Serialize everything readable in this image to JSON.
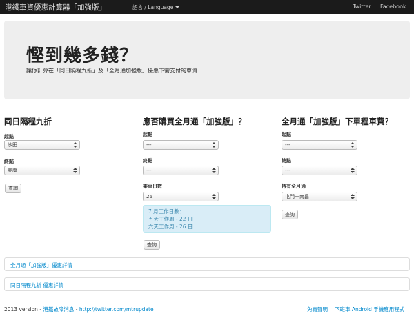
{
  "navbar": {
    "brand": "港鐵車資優惠計算器「加強版」",
    "language": "語言 / Language",
    "twitter": "Twitter",
    "facebook": "Facebook"
  },
  "hero": {
    "title": "慳到幾多錢？",
    "subtitle": "讓你計算在「同日隔程九折」及「全月通加強版」優惠下需支付的車資"
  },
  "col1": {
    "heading": "同日隔程九折",
    "from_label": "起點",
    "from_value": "沙田",
    "to_label": "終點",
    "to_value": "兆康",
    "button": "查詢"
  },
  "col2": {
    "heading": "應否購買全月通「加強版」？",
    "from_label": "起點",
    "from_value": "---",
    "to_label": "終點",
    "to_value": "---",
    "days_label": "乘車日數",
    "days_value": "26",
    "info_line1": "7 月工作日數：",
    "info_line2": "五天工作周 - 22 日",
    "info_line3": "六天工作周 - 26 日",
    "button": "查詢"
  },
  "col3": {
    "heading": "全月通「加強版」下單程車費？",
    "from_label": "起點",
    "from_value": "---",
    "to_label": "終點",
    "to_value": "---",
    "pass_label": "持有全月通",
    "pass_value": "屯門－南昌",
    "button": "查詢"
  },
  "panels": {
    "monthly_details": "全月通「加強版」優惠詳情",
    "sameday_details": "同日隔程九折 優惠詳情"
  },
  "footer": {
    "version": "2013 version - ",
    "news_link": "港鐵故障消息",
    "separator": " - ",
    "twitter_link": "http://twitter.com/mtrupdate",
    "disclaimer": "免責聲明",
    "android_app": "下班車 Android 手機應用程式"
  }
}
